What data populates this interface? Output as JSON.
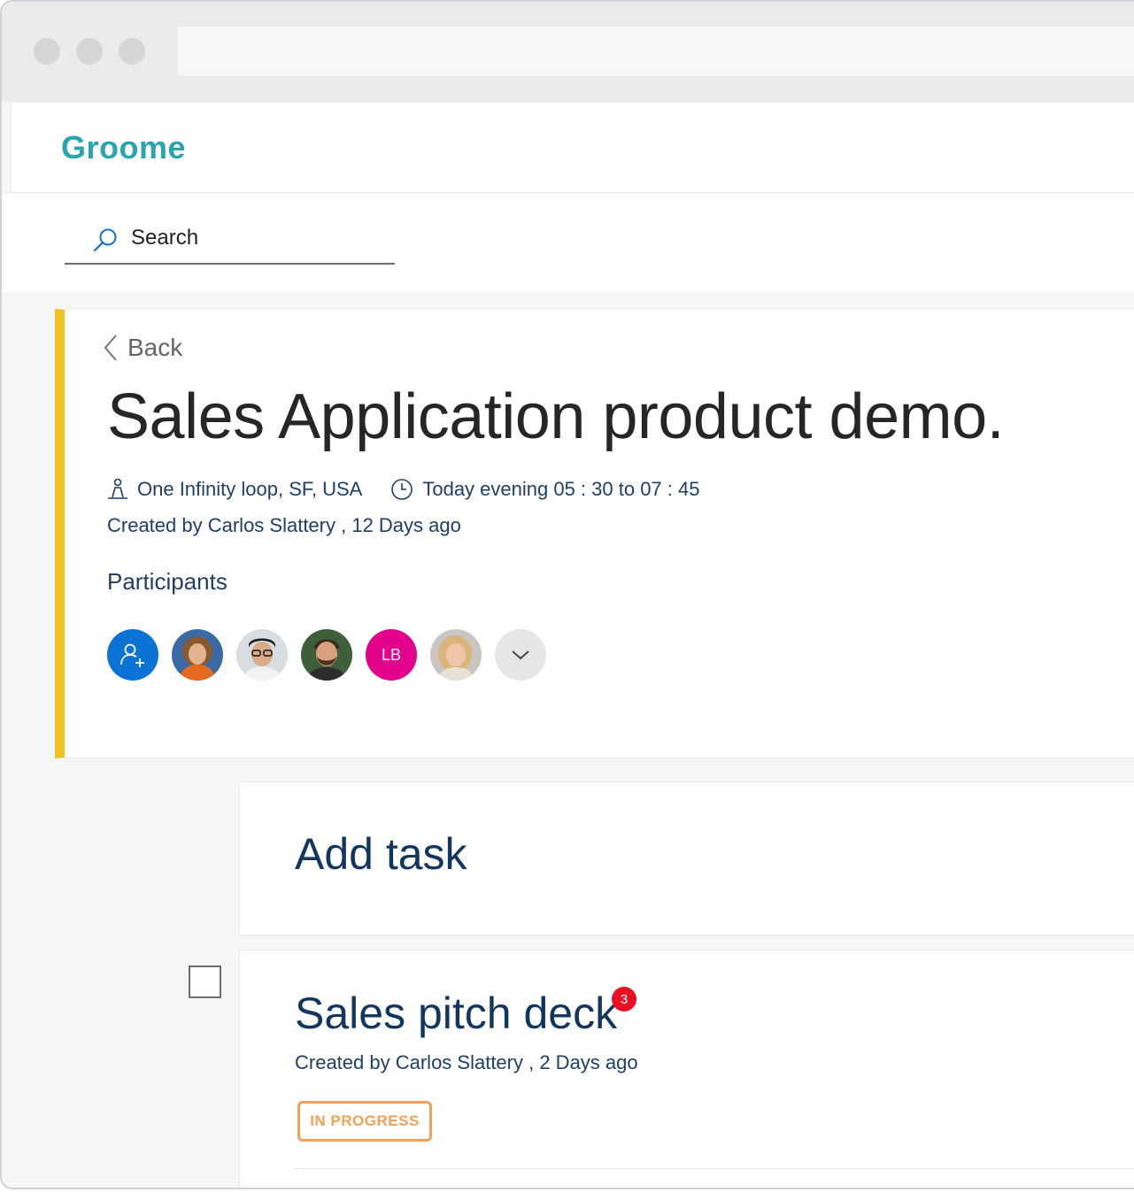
{
  "app": {
    "name": "Groome",
    "accent": "#2aa4ad"
  },
  "search": {
    "label": "Search",
    "icon": "search-icon"
  },
  "meeting": {
    "back_label": "Back",
    "title": "Sales Application product demo.",
    "location": "One Infinity loop, SF, USA",
    "time": "Today evening 05 : 30 to 07 : 45",
    "created": "Created by Carlos Slattery , 12 Days ago",
    "participants_label": "Participants",
    "accent": "#eec21f",
    "participants": [
      {
        "type": "add",
        "icon": "add-person-icon"
      },
      {
        "type": "photo",
        "icon": "avatar-woman-curly"
      },
      {
        "type": "photo",
        "icon": "avatar-man-glasses"
      },
      {
        "type": "photo",
        "icon": "avatar-man-beard"
      },
      {
        "type": "initials",
        "initials": "LB",
        "color": "#e3028c"
      },
      {
        "type": "photo",
        "icon": "avatar-woman-blonde"
      },
      {
        "type": "more",
        "icon": "chevron-down-icon"
      }
    ]
  },
  "add_task": {
    "label": "Add task"
  },
  "tasks": [
    {
      "title": "Sales pitch deck",
      "badge": "3",
      "created": "Created by Carlos Slattery ,  2 Days ago",
      "status": "IN PROGRESS",
      "status_color": "#f4a058"
    }
  ]
}
